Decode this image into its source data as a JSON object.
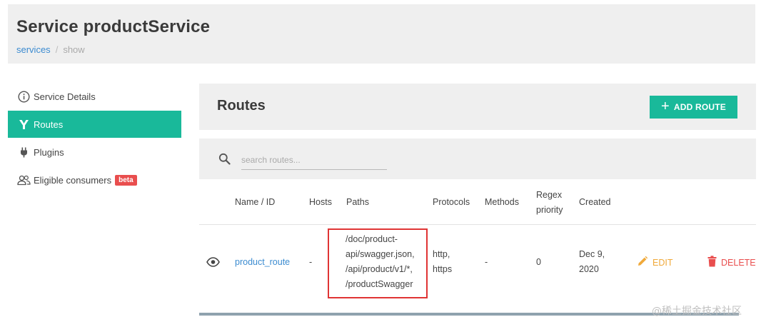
{
  "header": {
    "title": "Service productService",
    "breadcrumb": {
      "link": "services",
      "separator": "/",
      "current": "show"
    }
  },
  "sidebar": {
    "items": [
      {
        "label": "Service Details",
        "icon": "info-icon"
      },
      {
        "label": "Routes",
        "icon": "routes-icon",
        "active": true
      },
      {
        "label": "Plugins",
        "icon": "plug-icon"
      },
      {
        "label": "Eligible consumers",
        "icon": "users-icon",
        "badge": "beta"
      }
    ]
  },
  "routes": {
    "title": "Routes",
    "add_button_label": "ADD ROUTE",
    "search_placeholder": "search routes..."
  },
  "table": {
    "headers": {
      "name": "Name / ID",
      "hosts": "Hosts",
      "paths": "Paths",
      "protocols": "Protocols",
      "methods": "Methods",
      "regex_line1": "Regex",
      "regex_line2": "priority",
      "created": "Created"
    },
    "rows": [
      {
        "name": "product_route",
        "hosts": "-",
        "paths": [
          "/doc/product-",
          "api/swagger.json,",
          "/api/product/v1/*,",
          "/productSwagger"
        ],
        "protocols": [
          "http,",
          "https"
        ],
        "methods": "-",
        "regex_priority": "0",
        "created": [
          "Dec 9,",
          "2020"
        ],
        "edit_label": "EDIT",
        "delete_label": "DELETE"
      }
    ]
  },
  "colors": {
    "accent": "#19b99a",
    "link": "#3b8bd0",
    "danger": "#e94e4e",
    "warning": "#f0a93a",
    "panel_bg": "#efefef"
  },
  "watermark": "@稀土掘金技术社区"
}
